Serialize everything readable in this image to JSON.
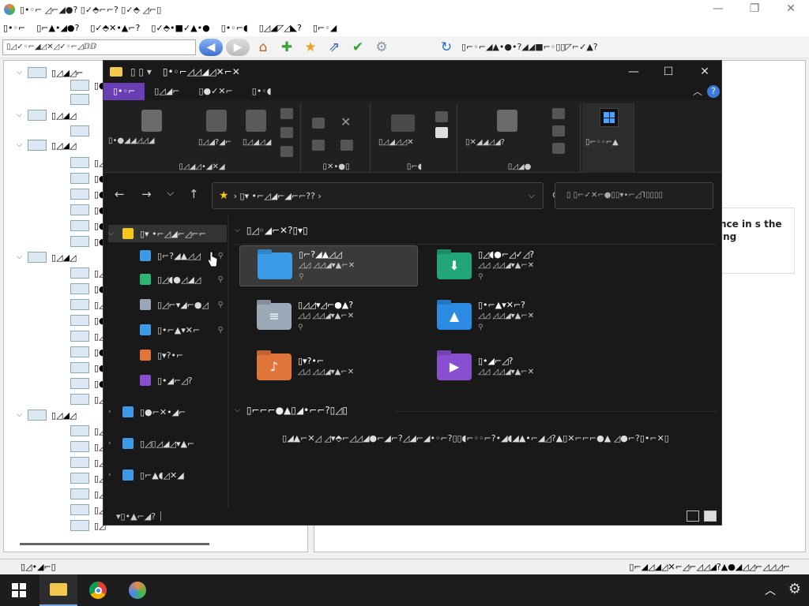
{
  "bg_app": {
    "title": "▯•◦⌐ ◿⌐◢●? ▯✓⬘⌐⌐? ▯✓⬘ ◿⌐▯",
    "menu": [
      "▯•◦⌐",
      "▯⌐▲•◢●?",
      "▯✓⬘✕•▲⌐?",
      "▯✓⬘•■✓▲•●",
      "▯•◦⌐◖",
      "▯◿◢◸◿◣?",
      "▯⌐◦◢"
    ],
    "address_value": "▯◿✓◦⌐◢◿✕◿✓◦⌐◿ⅅⅅ",
    "toolbar_text": "▯⌐◦⌐◢▲•●•?◢◢■⌐◦▯▯◸⌐✓▲?",
    "tree_items": [
      "▯◿◢◿⌐",
      "▯●",
      "",
      "▯◿◢◿",
      "",
      "▯◿◢◿",
      "▯◿",
      "▯●",
      "▯●",
      "▯●",
      "▯●",
      "▯●",
      "▯◿◢◿",
      "▯◿",
      "▯●",
      "▯◿",
      "▯●",
      "▯◿",
      "▯●",
      "▯●",
      "▯●",
      "▯◿",
      "▯◿◢◿",
      "▯◿",
      "▯◿",
      "▯◿",
      "▯◿",
      "▯◿",
      "▯◿",
      "▯◿"
    ],
    "right_note": "nce in s the ing",
    "status_left": "▯◿•◢⌐▯",
    "status_right": "▯⌐◢◿◢◿✕⌐◿⌐◿◿◢?▲●◢◿◿⌐◿◿◿⌐"
  },
  "explorer": {
    "title": "▯•◦⌐◿◿◢◿✕⌐✕",
    "quick_access": "▯ ▯ ▾",
    "window_controls": {
      "minimize": "—",
      "maximize": "☐",
      "close": "✕"
    },
    "tabs": [
      "▯•◦⌐",
      "▯◿◢⌐",
      "▯●✓✕⌐",
      "▯•◦◖"
    ],
    "help": "?",
    "ribbon": {
      "clipboard_label": "▯◿◢◿•◢✕◢",
      "pin_text": "▯•●◢◢◿◿◢",
      "copy_text": "▯◿◢?◢⌐",
      "paste_text": "▯◿◢◿◢",
      "organize_label": "▯✕•●▯",
      "new_label": "▯⌐◖",
      "new_folder_text": "▯◿◢◿◿✕",
      "open_label": "▯◿◢●",
      "open_text": "▯✕◢◢◿◢?",
      "select_text": "▯⌐◦◦⌐▲"
    },
    "nav": {
      "back": "←",
      "forward": "→",
      "recent": "⌵",
      "up": "↑"
    },
    "address": {
      "star": "★",
      "path": "› ▯▾ •⌐◿◢⌐◢⌐⌐?? ›",
      "dropdown": "⌵",
      "refresh": "⟳"
    },
    "search_placeholder": "▯  ▯⌐✓✕⌐●▯▯▾•⌐◿⅂▯▯▯▯",
    "sidebar": [
      {
        "label": "▯▾ •⌐◿◢⌐◿⌐⌐",
        "color": "#f5c518",
        "level": 0
      },
      {
        "label": "▯⌐?◢▲◿◿",
        "color": "#3b9be8",
        "level": 1,
        "pin": "📌"
      },
      {
        "label": "▯◿◖●◿◢◿",
        "color": "#2bb673",
        "level": 1,
        "pin": "📌"
      },
      {
        "label": "▯◿⌐▾◢⌐●◿",
        "color": "#9aa8b8",
        "level": 1,
        "pin": "📌"
      },
      {
        "label": "▯•⌐▲▾✕⌐",
        "color": "#3b9be8",
        "level": 1,
        "pin": "📌"
      },
      {
        "label": "▯▾?•⌐",
        "color": "#e0753a",
        "level": 1,
        "pin": ""
      },
      {
        "label": "▯•◢⌐◿?",
        "color": "#8a4fd0",
        "level": 1,
        "pin": ""
      },
      {
        "label": "▯●⌐✕•◢⌐",
        "color": "#3b9be8",
        "level": 0
      },
      {
        "label": "▯◿▯◿◢◿▾▲⌐",
        "color": "#3b9be8",
        "level": 0
      },
      {
        "label": "▯⌐▲◖◿✕◢",
        "color": "#3b9be8",
        "level": 0
      }
    ],
    "main": {
      "section1": "▯◿◦◢⌐✕?▯▾▯",
      "section2": "▯⌐⌐⌐●▲▯◢•⌐⌐?▯◿▯",
      "tiles": [
        {
          "name": "▯⌐?◢▲◿◿",
          "sub": "◿◿ ◿◿◢▾▲⌐✕",
          "color": "#3b9be8",
          "glyph": "",
          "pinned": true
        },
        {
          "name": "▯◿◖●⌐◿✓◿?",
          "sub": "◿◿ ◿◿◢▾▲⌐✕",
          "color": "#23a677",
          "glyph": "⬇",
          "pinned": true
        },
        {
          "name": "▯◿◿▾◿⌐●▲?",
          "sub": "◿◿ ◿◿◢▾▲⌐✕",
          "color": "#9aa8b8",
          "glyph": "≡",
          "pinned": true
        },
        {
          "name": "▯•⌐▲▾✕⌐?",
          "sub": "◿◿ ◿◿◢▾▲⌐✕",
          "color": "#2b8be3",
          "glyph": "▲",
          "pinned": true
        },
        {
          "name": "▯▾?•⌐",
          "sub": "◿◿ ◿◿◢▾▲⌐✕",
          "color": "#e0753a",
          "glyph": "♪",
          "pinned": false
        },
        {
          "name": "▯•◢⌐◿?",
          "sub": "◿◿ ◿◿◢▾▲⌐✕",
          "color": "#8a4fd0",
          "glyph": "▶",
          "pinned": false
        }
      ],
      "recent_message": "▯◢▲⌐✕◿ ◿▾⬘⌐◿◿◢●⌐◢⌐?◿◢⌐◢•◦⌐?▯▯◖⌐◦◦⌐?•◢◖◢▲•⌐◢◿?▲▯✕⌐⌐⌐●▲ ◿●⌐?▯•⌐✕▯"
    },
    "status_text": "▾▯•▲⌐◢? ⏐"
  },
  "taskbar": {
    "start": "⊞",
    "tray_chevron": "︿",
    "settings": "⚙"
  }
}
